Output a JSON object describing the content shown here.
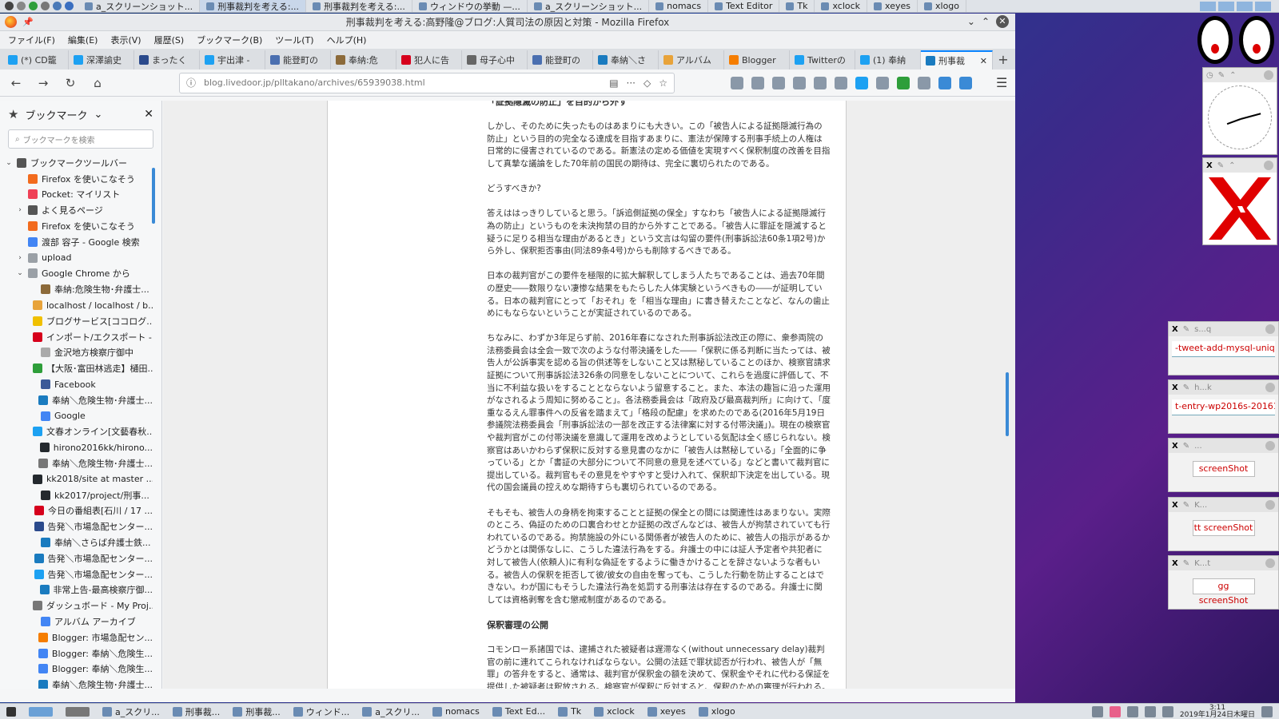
{
  "top_taskbar": {
    "tasks": [
      {
        "label": "a_スクリーンショット..."
      },
      {
        "label": "刑事裁判を考える:..."
      },
      {
        "label": "刑事裁判を考える:..."
      },
      {
        "label": "ウィンドウの挙動 —..."
      },
      {
        "label": "a_スクリーンショット..."
      },
      {
        "label": "nomacs"
      },
      {
        "label": "Text Editor"
      },
      {
        "label": "Tk"
      },
      {
        "label": "xclock"
      },
      {
        "label": "xeyes"
      },
      {
        "label": "xlogo"
      }
    ]
  },
  "window": {
    "title": "刑事裁判を考える:高野隆@ブログ:人質司法の原因と対策 - Mozilla Firefox"
  },
  "menubar": [
    "ファイル(F)",
    "編集(E)",
    "表示(V)",
    "履歴(S)",
    "ブックマーク(B)",
    "ツール(T)",
    "ヘルプ(H)"
  ],
  "tabs": [
    {
      "label": "(*) CD籠",
      "color": "#1da1f2"
    },
    {
      "label": "深澤諭史",
      "color": "#1da1f2"
    },
    {
      "label": "まったく",
      "color": "#2b4a8c"
    },
    {
      "label": "宇出津 -",
      "color": "#1da1f2"
    },
    {
      "label": "能登町の",
      "color": "#4a6fb0"
    },
    {
      "label": "奉納:危",
      "color": "#8c6a3a"
    },
    {
      "label": "犯人に告",
      "color": "#d6001c"
    },
    {
      "label": "母子心中",
      "color": "#666666"
    },
    {
      "label": "能登町の",
      "color": "#4a6fb0"
    },
    {
      "label": "奉納＼さ",
      "color": "#1a7bbf"
    },
    {
      "label": "アルバム",
      "color": "#e8a33a"
    },
    {
      "label": "Blogger",
      "color": "#f57d00"
    },
    {
      "label": "Twitterの",
      "color": "#1da1f2"
    },
    {
      "label": "(1) 奉納",
      "color": "#1da1f2"
    },
    {
      "label": "刑事裁",
      "color": "#1a7bbf",
      "selected": true
    }
  ],
  "navbar": {
    "url": "blog.livedoor.jp/plltakano/archives/65939038.html"
  },
  "sidebar": {
    "title": "ブックマーク",
    "search_placeholder": "ブックマークを検索",
    "items": [
      {
        "level": 0,
        "twisty": "v",
        "label": "ブックマークツールバー",
        "color": "#555555"
      },
      {
        "level": 1,
        "twisty": "",
        "label": "Firefox を使いこなそう",
        "color": "#f26b1d"
      },
      {
        "level": 1,
        "twisty": "",
        "label": "Pocket: マイリスト",
        "color": "#ef4056"
      },
      {
        "level": 1,
        "twisty": ">",
        "label": "よく見るページ",
        "color": "#555555"
      },
      {
        "level": 1,
        "twisty": "",
        "label": "Firefox を使いこなそう",
        "color": "#f26b1d"
      },
      {
        "level": 1,
        "twisty": "",
        "label": "渡部 容子 - Google 検索",
        "color": "#4285f4"
      },
      {
        "level": 1,
        "twisty": ">",
        "label": "upload",
        "color": "#9aa0a6"
      },
      {
        "level": 1,
        "twisty": "v",
        "label": "Google Chrome から",
        "color": "#9aa0a6"
      },
      {
        "level": 2,
        "twisty": "",
        "label": "奉納:危険生物･弁護士...",
        "color": "#8c6a3a"
      },
      {
        "level": 2,
        "twisty": "",
        "label": "localhost / localhost / b...",
        "color": "#e8a33a"
      },
      {
        "level": 2,
        "twisty": "",
        "label": "ブログサービス[ココログ...",
        "color": "#f0c000"
      },
      {
        "level": 2,
        "twisty": "",
        "label": "インポート/エクスポート -...",
        "color": "#d6001c"
      },
      {
        "level": 2,
        "twisty": "",
        "label": "金沢地方検察庁御中",
        "color": "#aaaaaa"
      },
      {
        "level": 2,
        "twisty": "",
        "label": "【大阪･富田林逃走】樋田...",
        "color": "#2e9e3a"
      },
      {
        "level": 2,
        "twisty": "",
        "label": "Facebook",
        "color": "#3b5998"
      },
      {
        "level": 2,
        "twisty": "",
        "label": "奉納＼危険生物･弁護士...",
        "color": "#1a7bbf"
      },
      {
        "level": 2,
        "twisty": "",
        "label": "Google",
        "color": "#4285f4"
      },
      {
        "level": 2,
        "twisty": "",
        "label": "文春オンライン[文藝春秋...",
        "color": "#1da1f2"
      },
      {
        "level": 2,
        "twisty": "",
        "label": "hirono2016kk/hirono...",
        "color": "#24292e"
      },
      {
        "level": 2,
        "twisty": "",
        "label": "奉納＼危険生物･弁護士...",
        "color": "#777777"
      },
      {
        "level": 2,
        "twisty": "",
        "label": "kk2018/site at master ...",
        "color": "#24292e"
      },
      {
        "level": 2,
        "twisty": "",
        "label": "kk2017/project/刑事...",
        "color": "#24292e"
      },
      {
        "level": 2,
        "twisty": "",
        "label": "今日の番組表[石川 / 17 ...",
        "color": "#d6001c"
      },
      {
        "level": 2,
        "twisty": "",
        "label": "告発＼市場急配センター...",
        "color": "#2b4a8c"
      },
      {
        "level": 2,
        "twisty": "",
        "label": "奉納＼さらば弁護士鉄...",
        "color": "#1a7bbf"
      },
      {
        "level": 2,
        "twisty": "",
        "label": "告発＼市場急配センター...",
        "color": "#1a7bbf"
      },
      {
        "level": 2,
        "twisty": "",
        "label": "告発＼市場急配センター...",
        "color": "#1da1f2"
      },
      {
        "level": 2,
        "twisty": "",
        "label": "非常上告-最高検察庁御...",
        "color": "#1a7bbf"
      },
      {
        "level": 2,
        "twisty": "",
        "label": "ダッシュボード - My Proj...",
        "color": "#777777"
      },
      {
        "level": 2,
        "twisty": "",
        "label": "アルバム アーカイブ",
        "color": "#4285f4"
      },
      {
        "level": 2,
        "twisty": "",
        "label": "Blogger: 市場急配セン...",
        "color": "#f57d00"
      },
      {
        "level": 2,
        "twisty": "",
        "label": "Blogger: 奉納＼危険生...",
        "color": "#4285f4"
      },
      {
        "level": 2,
        "twisty": "",
        "label": "Blogger: 奉納＼危険生...",
        "color": "#4285f4"
      },
      {
        "level": 2,
        "twisty": "",
        "label": "奉納＼危険生物･弁護士...",
        "color": "#1a7bbf"
      }
    ]
  },
  "article": {
    "top_heading": "「証拠隠滅の防止」を目的から外す",
    "p1": "しかし、そのために失ったものはあまりにも大きい。この「被告人による証拠隠滅行為の防止」という目的の完全なる達成を目指すあまりに、憲法が保障する刑事手続上の人権は日常的に侵害されているのである。新憲法の定める価値を実現すべく保釈制度の改善を目指して真摯な議論をした70年前の国民の期待は、完全に裏切られたのである。",
    "h2": "どうすべきか?",
    "p2": "答えははっきりしていると思う。「訴追側証拠の保全」すなわち「被告人による証拠隠滅行為の防止」というものを未決拘禁の目的から外すことである。「被告人に罪証を隠滅すると疑うに足りる相当な理由があるとき」という文言は勾留の要件(刑事訴訟法60条1項2号)から外し、保釈拒否事由(同法89条4号)からも削除するべきである。",
    "p3": "日本の裁判官がこの要件を極限的に拡大解釈してしまう人たちであることは、過去70年間の歴史――数限りない凄惨な結果をもたらした人体実験というべきもの――が証明している。日本の裁判官にとって「おそれ」を「相当な理由」に書き替えたことなど、なんの歯止めにもならないということが実証されているのである。",
    "p4": "ちなみに、わずか3年足らず前、2016年春になされた刑事訴訟法改正の際に、衆参両院の法務委員会は全会一致で次のような付帯決議をした――「保釈に係る判断に当たっては、被告人が公訴事実を認める旨の供述等をしないこと又は黙秘していることのほか、検察官請求証拠について刑事訴訟法326条の同意をしないことについて、これらを過度に評価して、不当に不利益な扱いをすることとならないよう留意すること。また、本法の趣旨に沿った運用がなされるよう周知に努めること」。各法務委員会は「政府及び最高裁判所」に向けて、「度重なるえん罪事件への反省を踏まえて」「格段の配慮」を求めたのである(2016年5月19日参議院法務委員会「刑事訴訟法の一部を改正する法律案に対する付帯決議」)。現在の検察官や裁判官がこの付帯決議を意識して運用を改めようとしている気配は全く感じられない。検察官はあいかわらず保釈に反対する意見書のなかに「被告人は黙秘している」「全面的に争っている」とか「書証の大部分について不同意の意見を述べている」などと書いて裁判官に提出している。裁判官もその意見をやすやすと受け入れて、保釈却下決定を出している。現代の国会議員の控えめな期待すらも裏切られているのである。",
    "p5": "そもそも、被告人の身柄を拘束することと証拠の保全との間には関連性はあまりない。実際のところ、偽証のための口裏合わせとか証拠の改ざんなどは、被告人が拘禁されていても行われているのである。拘禁施設の外にいる関係者が被告人のために、被告人の指示があるかどうかとは関係なしに、こうした違法行為をする。弁護士の中には証人予定者や共犯者に対して被告人(依頼人)に有利な偽証をするように働きかけることを辞さないような者もいる。被告人の保釈を拒否して彼/彼女の自由を奪っても、こうした行動を防止することはできない。わが国にもそうした違法行為を処罰する刑事法は存在するのである。弁護士に関しては資格剥奪を含む懲戒制度があるのである。",
    "h3": "保釈審理の公開",
    "p6": "コモンロー系諸国では、逮捕された被疑者は遅滞なく(without unnecessary delay)裁判官の前に連れてこられなければならない。公開の法廷で罪状認否が行われ、被告人が「無罪」の答弁をすると、通常は、裁判官が保釈金の額を決めて、保釈金やそれに代わる保証を提供した被疑者は釈放される。検察官が保釈に反対すると、保釈のための審理が行われる。この審理も公開"
  },
  "xnotes": [
    {
      "title": "s...q",
      "value": "-tweet-add-mysql-uniq.rb"
    },
    {
      "title": "h...k",
      "value": "t-entry-wp2016s-20161"
    },
    {
      "title": "...",
      "button": "screenShot"
    },
    {
      "title": "K...",
      "button": "tt screenShot"
    },
    {
      "title": "K...t",
      "button": "gg screenShot"
    }
  ],
  "bottom_taskbar": {
    "tasks": [
      "a_スクリ...",
      "刑事裁...",
      "刑事裁...",
      "ウィンド...",
      "a_スクリ...",
      "nomacs",
      "Text Ed...",
      "Tk",
      "xclock",
      "xeyes",
      "xlogo"
    ],
    "time": "3:11",
    "date": "2019年1月24日木曜日"
  }
}
